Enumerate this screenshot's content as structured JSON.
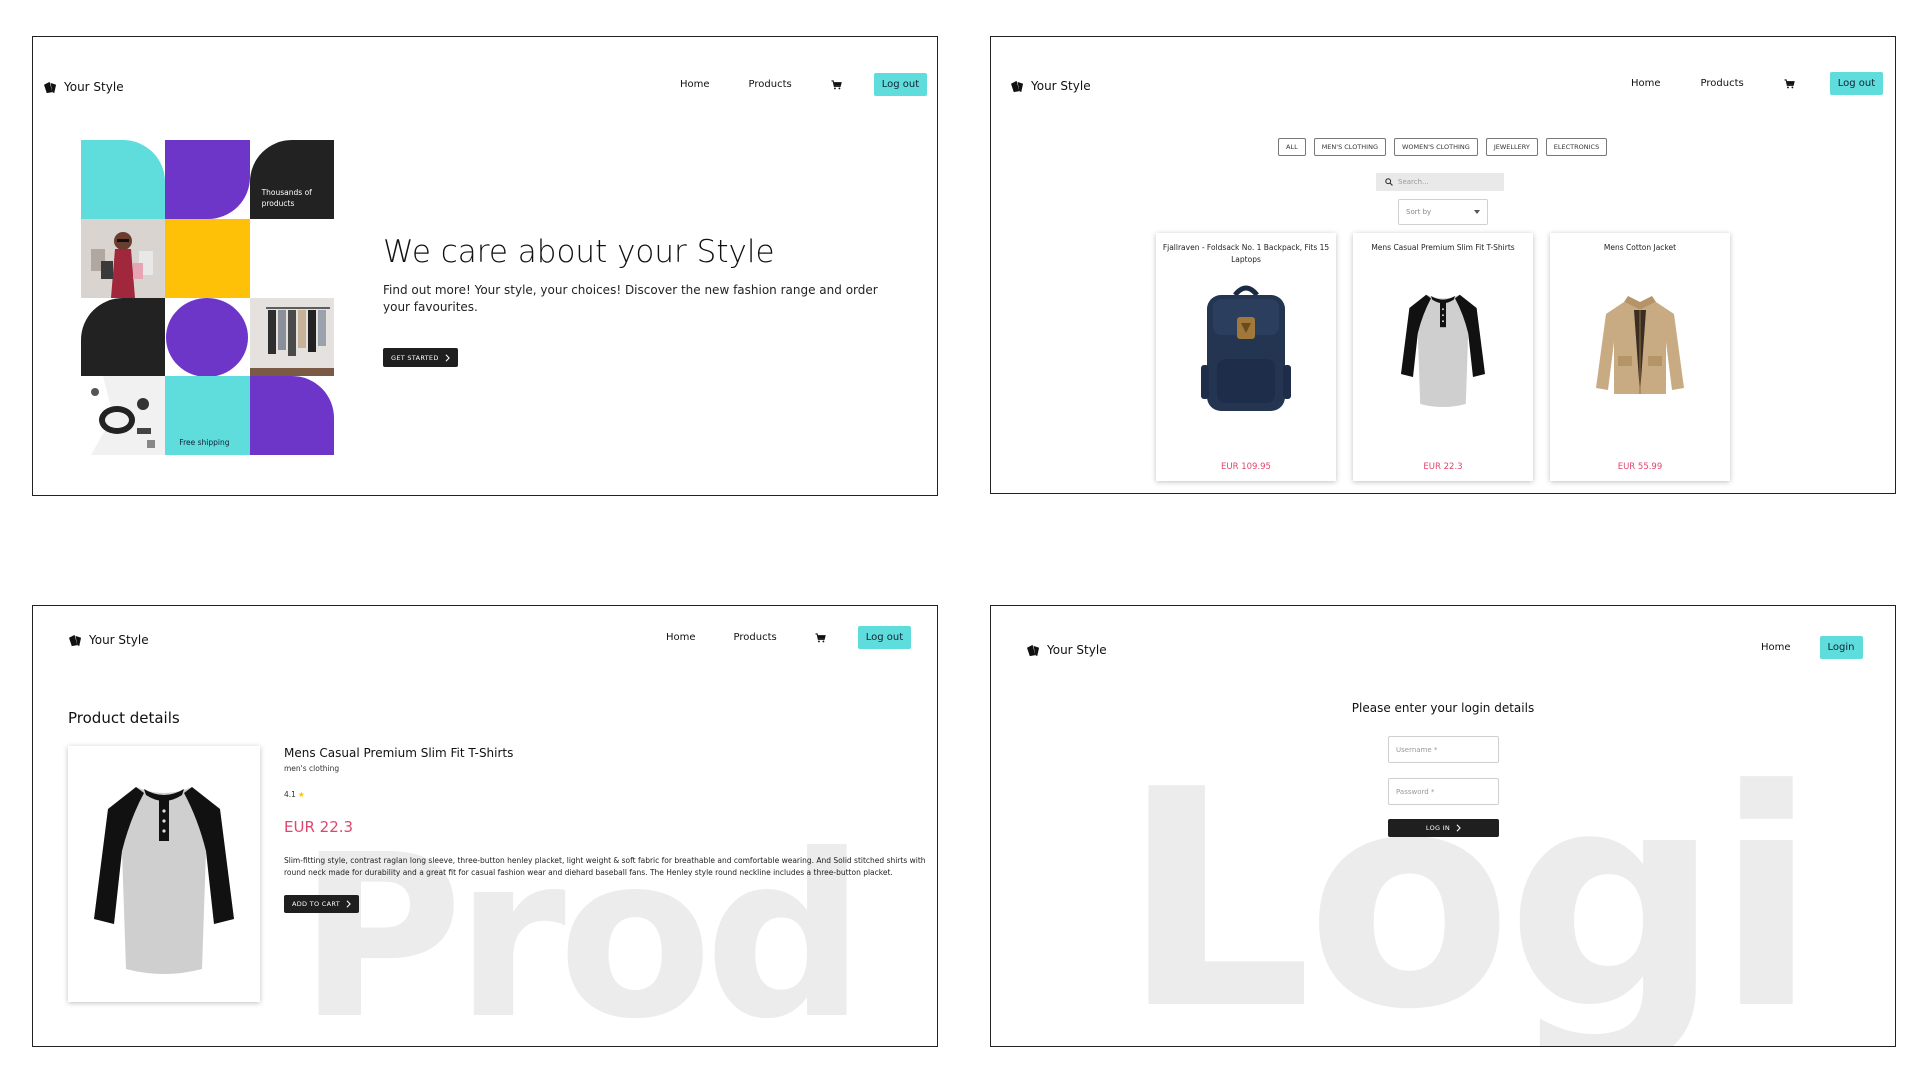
{
  "brand": {
    "name": "Your Style"
  },
  "nav": {
    "home": "Home",
    "products": "Products",
    "logout": "Log out",
    "login": "Login"
  },
  "colors": {
    "accent_cyan": "#5fdcdc",
    "accent_purple": "#6e35c9",
    "accent_yellow": "#ffc107",
    "dark": "#1f1f1f",
    "price_pink": "#e0456e"
  },
  "landing": {
    "tile_thousands": "Thousands of products",
    "tile_shipping": "Free shipping",
    "title": "We care about your Style",
    "subtitle": "Find out more! Your style, your choices! Discover the new fashion range and order your favourites.",
    "cta": "GET STARTED"
  },
  "catalog": {
    "filters": [
      "ALL",
      "MEN'S CLOTHING",
      "WOMEN'S CLOTHING",
      "JEWELLERY",
      "ELECTRONICS"
    ],
    "search_placeholder": "Search...",
    "sort_label": "Sort by",
    "products": [
      {
        "title": "Fjallraven - Foldsack No. 1 Backpack, Fits 15 Laptops",
        "price": "EUR 109.95",
        "image": "backpack-image"
      },
      {
        "title": "Mens Casual Premium Slim Fit T-Shirts",
        "price": "EUR 22.3",
        "image": "tshirt-image"
      },
      {
        "title": "Mens Cotton Jacket",
        "price": "EUR 55.99",
        "image": "jacket-image"
      }
    ]
  },
  "details": {
    "heading": "Product details",
    "name": "Mens Casual Premium Slim Fit T-Shirts",
    "category": "men's clothing",
    "rating": "4.1",
    "price": "EUR 22.3",
    "description": "Slim-fitting style, contrast raglan long sleeve, three-button henley placket, light weight & soft fabric for breathable and comfortable wearing. And Solid stitched shirts with round neck made for durability and a great fit for casual fashion wear and diehard baseball fans. The Henley style round neckline includes a three-button placket.",
    "cta": "ADD TO CART",
    "bg_word": "Prod"
  },
  "login": {
    "prompt": "Please enter your login details",
    "username_placeholder": "Username *",
    "password_placeholder": "Password *",
    "button": "LOG IN",
    "bg_word": "Logi"
  }
}
